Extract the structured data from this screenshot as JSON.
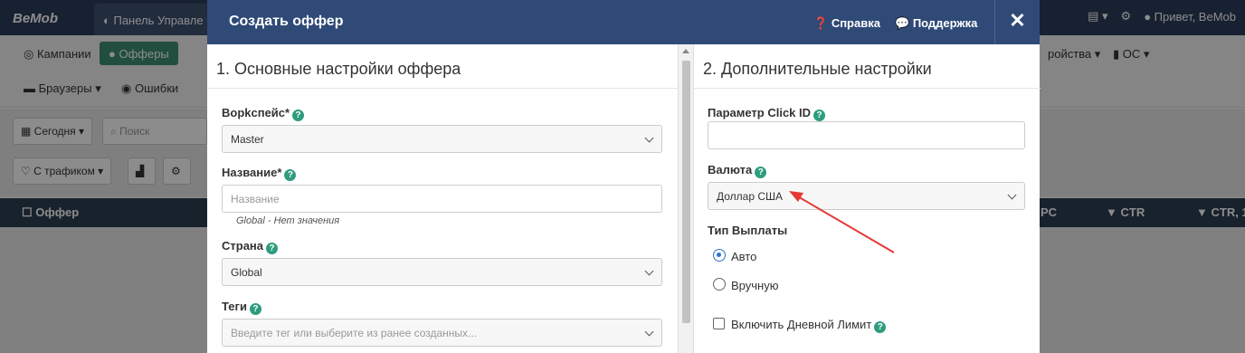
{
  "background": {
    "logo": "BeMob",
    "dashboard_tab": "Панель Управле",
    "greeting": "Привет, BeMob",
    "nav": {
      "campaigns": "Кампании",
      "offers": "Офферы",
      "devices": "ройства",
      "os": "ОС",
      "browsers": "Браузеры",
      "errors": "Ошибки"
    },
    "filters": {
      "date": "Сегодня",
      "search_placeholder": "Поиск",
      "traffic": "С трафиком"
    },
    "table_headers": {
      "offer": "Оффер",
      "pc": "PC",
      "ctr": "CTR",
      "ctr2": "CTR, 1"
    }
  },
  "modal": {
    "title": "Создать оффер",
    "help_link": "Справка",
    "support_link": "Поддержка",
    "close": "✕",
    "left": {
      "section_title": "1. Основные настройки оффера",
      "workspace_label": "Ворkспейс*",
      "workspace_value": "Master",
      "name_label": "Название*",
      "name_placeholder": "Название",
      "name_hint": "Global - Нет значения",
      "country_label": "Страна",
      "country_value": "Global",
      "tags_label": "Теги",
      "tags_placeholder": "Введите тег или выберите из ранее созданных..."
    },
    "right": {
      "section_title": "2. Дополнительные настройки",
      "clickid_label": "Параметр Click ID",
      "clickid_value": "",
      "currency_label": "Валюта",
      "currency_value": "Доллар США",
      "payout_label": "Тип Выплаты",
      "payout_auto": "Авто",
      "payout_manual": "Вручную",
      "daily_limit_label": "Включить Дневной Лимит"
    }
  },
  "colors": {
    "header": "#2f4a77",
    "accent_green": "#2e9c7e",
    "radio_blue": "#2e73c7",
    "arrow_red": "#e53935"
  }
}
